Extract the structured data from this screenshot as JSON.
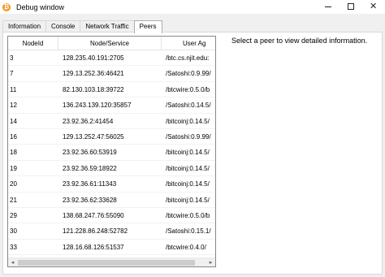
{
  "window": {
    "title": "Debug window",
    "app_icon": "bitcoin-icon",
    "controls": {
      "minimize_icon": "minimize-icon",
      "maximize_icon": "maximize-icon",
      "close_icon": "close-icon",
      "close_glyph": "✕"
    }
  },
  "tabs": [
    {
      "label": "Information",
      "active": false
    },
    {
      "label": "Console",
      "active": false
    },
    {
      "label": "Network Traffic",
      "active": false
    },
    {
      "label": "Peers",
      "active": true
    }
  ],
  "peers_table": {
    "columns": {
      "id": "NodeId",
      "node": "Node/Service",
      "user_agent": "User Ag"
    },
    "rows": [
      {
        "id": "3",
        "node": "128.235.40.191:2705",
        "user_agent": "/btc.cs.njit.edu:"
      },
      {
        "id": "7",
        "node": "129.13.252.36:46421",
        "user_agent": "/Satoshi:0.9.99/"
      },
      {
        "id": "11",
        "node": "82.130.103.18:39722",
        "user_agent": "/btcwire:0.5.0/b"
      },
      {
        "id": "12",
        "node": "136.243.139.120:35857",
        "user_agent": "/Satoshi:0.14.5/"
      },
      {
        "id": "14",
        "node": "23.92.36.2:41454",
        "user_agent": "/bitcoinj:0.14.5/"
      },
      {
        "id": "16",
        "node": "129.13.252.47:56025",
        "user_agent": "/Satoshi:0.9.99/"
      },
      {
        "id": "18",
        "node": "23.92.36.60:53919",
        "user_agent": "/bitcoinj:0.14.5/"
      },
      {
        "id": "19",
        "node": "23.92.36.59:18922",
        "user_agent": "/bitcoinj:0.14.5/"
      },
      {
        "id": "20",
        "node": "23.92.36.61:11343",
        "user_agent": "/bitcoinj:0.14.5/"
      },
      {
        "id": "21",
        "node": "23.92.36.62:33628",
        "user_agent": "/bitcoinj:0.14.5/"
      },
      {
        "id": "29",
        "node": "138.68.247.76:55090",
        "user_agent": "/btcwire:0.5.0/b"
      },
      {
        "id": "30",
        "node": "121.228.86.248:52782",
        "user_agent": "/Satoshi:0.15.1/"
      },
      {
        "id": "33",
        "node": "128.16.68.126:51537",
        "user_agent": "/btcwire:0.4.0/"
      }
    ],
    "scroll_left_icon": "scroll-left-icon",
    "scroll_right_icon": "scroll-right-icon",
    "scroll_left_glyph": "◂",
    "scroll_right_glyph": "▸"
  },
  "detail": {
    "message": "Select a peer to view detailed information."
  }
}
